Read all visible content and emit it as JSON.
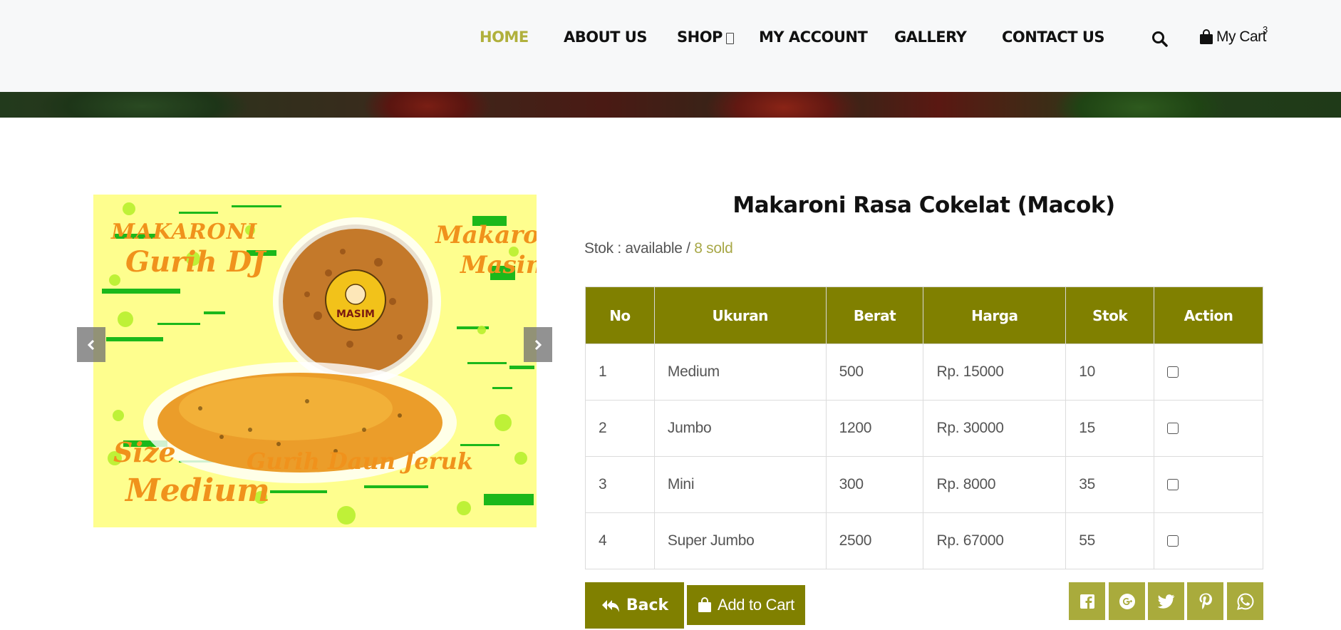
{
  "nav": {
    "home": "HOME",
    "about": "ABOUT US",
    "shop": "SHOP",
    "account": "MY ACCOUNT",
    "gallery": "GALLERY",
    "contact": "CONTACT US",
    "cart_label": "My Cart",
    "cart_count": "3",
    "active_color": "#b0b03c"
  },
  "product": {
    "title": "Makaroni Rasa Cokelat (Macok)",
    "stock_prefix": "Stok : available / ",
    "sold": "8 sold",
    "image_text": {
      "brand_left_1": "MAKARONI",
      "brand_left_2": "Gurih DJ",
      "brand_right_1": "Makaroni",
      "brand_right_2": "Masim",
      "lid_label": "MASIM",
      "size_1": "Size",
      "size_2": "Medium",
      "flavor": "Gurih Daun Jeruk"
    },
    "slider": {
      "prev_icon": "chevron-left-icon",
      "next_icon": "chevron-right-icon"
    }
  },
  "table": {
    "headers": [
      "No",
      "Ukuran",
      "Berat",
      "Harga",
      "Stok",
      "Action"
    ],
    "rows": [
      [
        "1",
        "Medium",
        "500",
        "Rp. 15000",
        "10"
      ],
      [
        "2",
        "Jumbo",
        "1200",
        "Rp. 30000",
        "15"
      ],
      [
        "3",
        "Mini",
        "300",
        "Rp. 8000",
        "35"
      ],
      [
        "4",
        "Super Jumbo",
        "2500",
        "Rp. 67000",
        "55"
      ]
    ],
    "header_color": "#808000"
  },
  "actions": {
    "back": "Back",
    "add_to_cart": "Add to Cart",
    "share_icons": [
      "facebook-icon",
      "google-plus-icon",
      "twitter-icon",
      "pinterest-icon",
      "whatsapp-icon"
    ],
    "share_color": "#a9ab3c"
  }
}
